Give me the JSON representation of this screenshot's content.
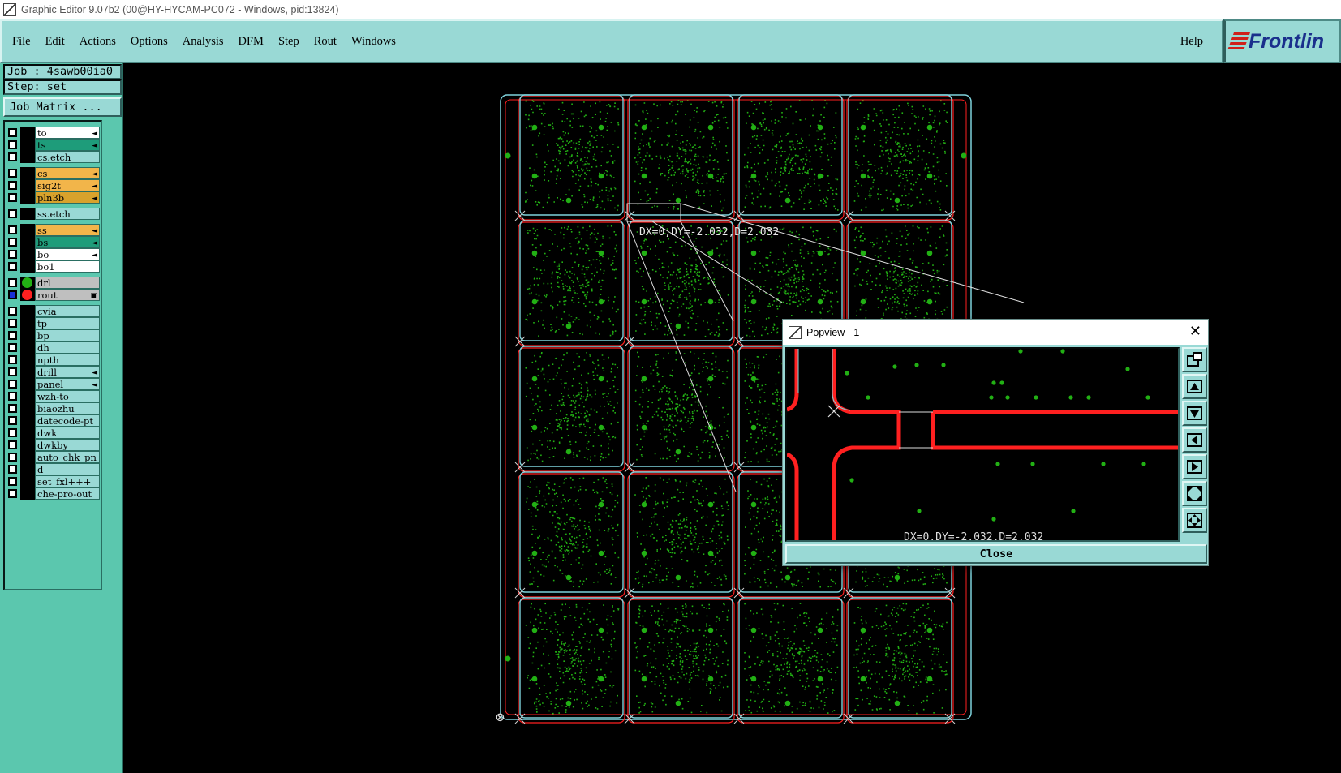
{
  "window": {
    "title": "Graphic Editor 9.07b2 (00@HY-HYCAM-PC072 - Windows, pid:13824)"
  },
  "menu": {
    "items": [
      {
        "label": "File"
      },
      {
        "label": "Edit"
      },
      {
        "label": "Actions"
      },
      {
        "label": "Options"
      },
      {
        "label": "Analysis"
      },
      {
        "label": "DFM"
      },
      {
        "label": "Step"
      },
      {
        "label": "Rout"
      },
      {
        "label": "Windows"
      }
    ],
    "help": "Help",
    "logo": "Frontlin"
  },
  "panel": {
    "job": "Job : 4sawb00ia0",
    "step": "Step: set",
    "job_matrix": "Job Matrix ..."
  },
  "layers": [
    {
      "name": "to",
      "color": "#ffffff",
      "mark": "◄"
    },
    {
      "name": "ts",
      "color": "#1e9c7a",
      "mark": "◄"
    },
    {
      "name": "cs.etch",
      "color": "#99d9d5",
      "mark": ""
    },
    {
      "name": "cs",
      "color": "#f2b54a",
      "mark": "◄"
    },
    {
      "name": "sig2t",
      "color": "#f2b54a",
      "mark": "◄"
    },
    {
      "name": "pln3b",
      "color": "#d8a22c",
      "mark": "◄"
    },
    {
      "name": "ss.etch",
      "color": "#99d9d5",
      "mark": ""
    },
    {
      "name": "ss",
      "color": "#f2b54a",
      "mark": "◄"
    },
    {
      "name": "bs",
      "color": "#1e9c7a",
      "mark": "◄"
    },
    {
      "name": "bo",
      "color": "#ffffff",
      "mark": "◄"
    },
    {
      "name": "bo1",
      "color": "#ffffff",
      "mark": ""
    },
    {
      "name": "drl",
      "color": "#bfbfbf",
      "mark": "",
      "dot": "#22b014"
    },
    {
      "name": "rout",
      "color": "#bfbfbf",
      "mark": "▣",
      "dot": "#ff2020",
      "active": true
    },
    {
      "name": "cvia",
      "color": "#99d9d5",
      "mark": ""
    },
    {
      "name": "tp",
      "color": "#99d9d5",
      "mark": ""
    },
    {
      "name": "bp",
      "color": "#99d9d5",
      "mark": ""
    },
    {
      "name": "dh",
      "color": "#99d9d5",
      "mark": ""
    },
    {
      "name": "npth",
      "color": "#99d9d5",
      "mark": ""
    },
    {
      "name": "drill",
      "color": "#99d9d5",
      "mark": "◄"
    },
    {
      "name": "panel",
      "color": "#99d9d5",
      "mark": "◄"
    },
    {
      "name": "wzh-to",
      "color": "#99d9d5",
      "mark": ""
    },
    {
      "name": "biaozhu",
      "color": "#99d9d5",
      "mark": ""
    },
    {
      "name": "datecode-pt",
      "color": "#99d9d5",
      "mark": ""
    },
    {
      "name": "dwk",
      "color": "#99d9d5",
      "mark": ""
    },
    {
      "name": "dwkby",
      "color": "#99d9d5",
      "mark": ""
    },
    {
      "name": "auto_chk_pn",
      "color": "#99d9d5",
      "mark": ""
    },
    {
      "name": "d",
      "color": "#99d9d5",
      "mark": ""
    },
    {
      "name": "set_fxl+++",
      "color": "#99d9d5",
      "mark": ""
    },
    {
      "name": "che-pro-out",
      "color": "#99d9d5",
      "mark": ""
    }
  ],
  "canvas": {
    "measure_label": "DX=0,DY=-2.032,D=2.032"
  },
  "popview": {
    "title": "Popview - 1",
    "coord_label": "DX=0,DY=-2.032,D=2.032",
    "close": "Close",
    "tools": [
      "zoom-window-icon",
      "pan-up-icon",
      "pan-down-icon",
      "pan-left-icon",
      "pan-right-icon",
      "zoom-in-icon",
      "zoom-out-icon"
    ]
  },
  "colors": {
    "panel_bg": "#99d9d5",
    "sidebar": "#5bc7ae",
    "rout": "#ff2020",
    "outline": "#7fd3dc",
    "pads": "#22b014"
  }
}
